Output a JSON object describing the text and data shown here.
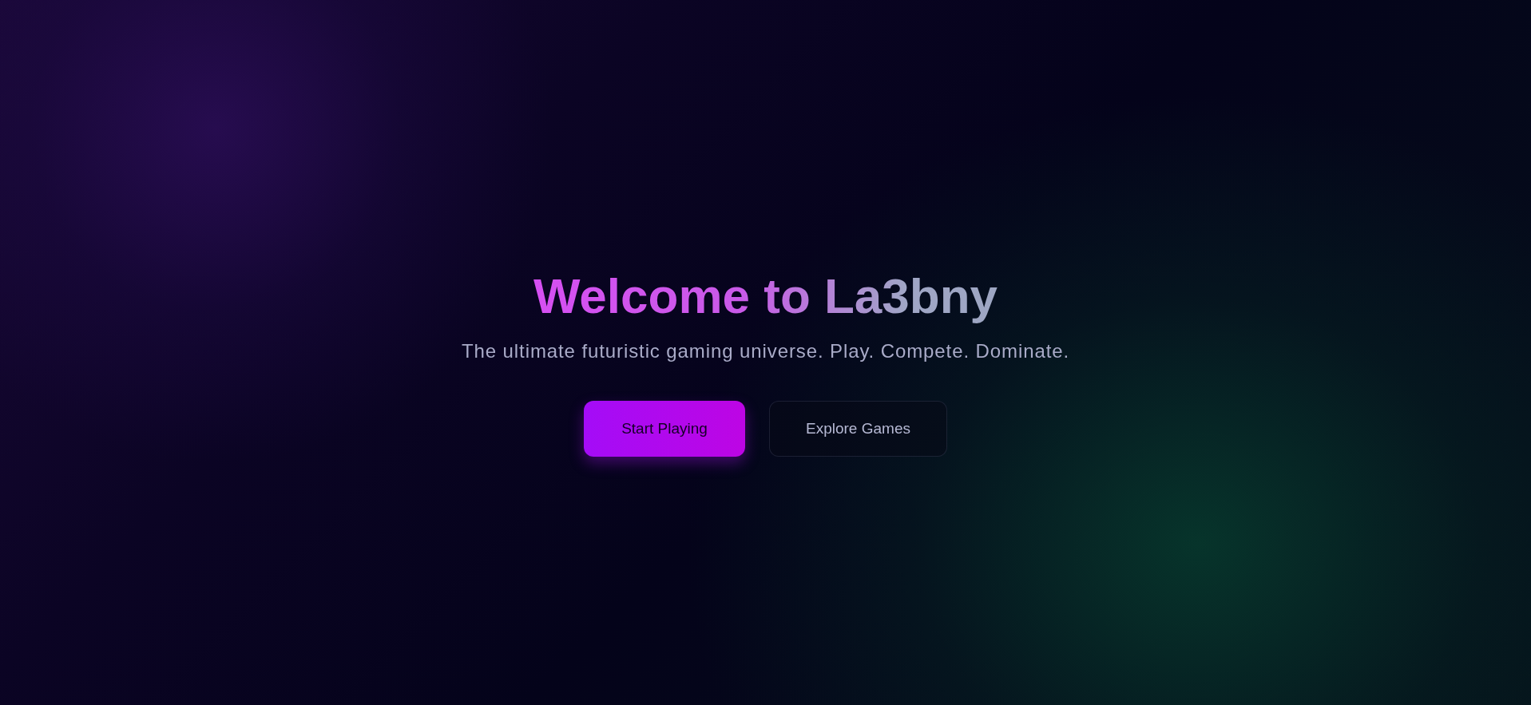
{
  "hero": {
    "title": "Welcome to La3bny",
    "subtitle": "The ultimate futuristic gaming universe. Play. Compete. Dominate.",
    "buttons": [
      {
        "label": "Start Playing",
        "kind": "primary"
      },
      {
        "label": "Explore Games",
        "kind": "secondary"
      }
    ]
  }
}
